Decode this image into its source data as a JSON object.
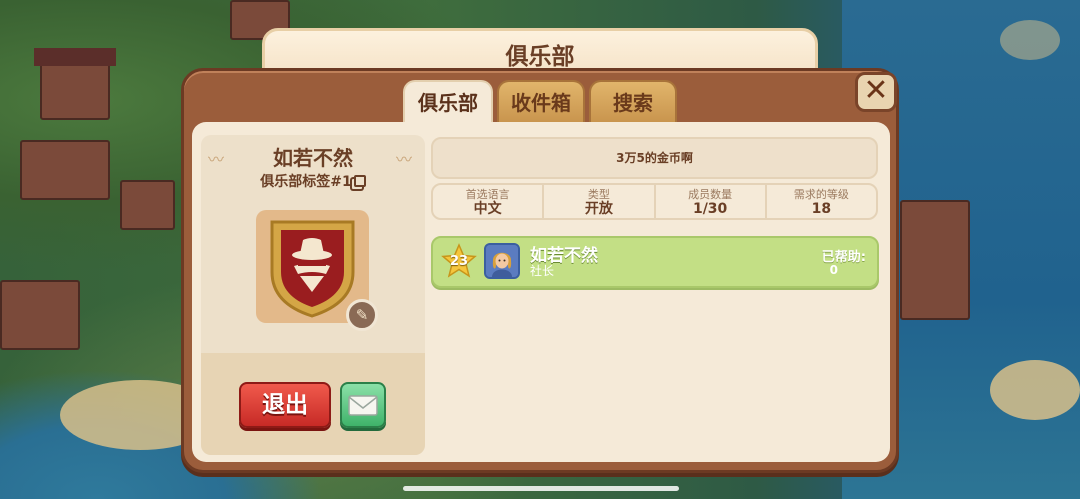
{
  "window": {
    "title": "俱乐部"
  },
  "tabs": [
    {
      "label": "俱乐部",
      "active": true
    },
    {
      "label": "收件箱",
      "active": false
    },
    {
      "label": "搜索",
      "active": false
    }
  ],
  "close_icon": "close-icon",
  "club": {
    "name": "如若不然",
    "tag": "俱乐部标签#1",
    "badge_icon": "spy-mask-shield-icon",
    "edit_icon": "pencil-icon",
    "description": "3万5的金币啊",
    "stats": [
      {
        "label": "首选语言",
        "value": "中文"
      },
      {
        "label": "类型",
        "value": "开放"
      },
      {
        "label": "成员数量",
        "value": "1/30"
      },
      {
        "label": "需求的等级",
        "value": "18"
      }
    ]
  },
  "actions": {
    "exit_label": "退出",
    "mail_icon": "mail-icon"
  },
  "members": [
    {
      "level": "23",
      "name": "如若不然",
      "role": "社长",
      "helped_label": "已帮助:",
      "helped_value": "0"
    }
  ],
  "colors": {
    "panel": "#9b5d3b",
    "content": "#f5ead8",
    "exit": "#d9342e",
    "mail": "#4fc27a",
    "member_row": "#c3df85"
  }
}
